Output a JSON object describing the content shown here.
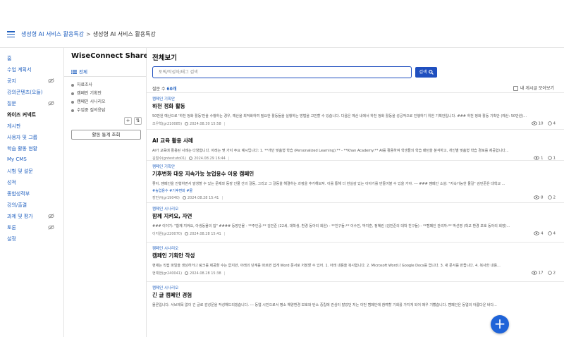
{
  "breadcrumb": {
    "link": "생성형 AI 서비스 활용특강",
    "separator": ">",
    "current": "생성형 AI 서비스 활용특강"
  },
  "leftnav": {
    "items": [
      {
        "label": "홈",
        "hidden_icon": false
      },
      {
        "label": "수업 계획서",
        "hidden_icon": false
      },
      {
        "label": "공지",
        "hidden_icon": true
      },
      {
        "label": "강의콘텐츠(오들)",
        "hidden_icon": false
      },
      {
        "label": "질문",
        "hidden_icon": true
      },
      {
        "label": "와이즈 커넥트",
        "hidden_icon": false,
        "active": true
      },
      {
        "label": "게시판",
        "hidden_icon": false
      },
      {
        "label": "사용자 및 그룹",
        "hidden_icon": false
      },
      {
        "label": "학습 활동 현황",
        "hidden_icon": false
      },
      {
        "label": "My CMS",
        "hidden_icon": false
      },
      {
        "label": "시험 및 설문",
        "hidden_icon": false
      },
      {
        "label": "성적",
        "hidden_icon": false
      },
      {
        "label": "종합성적부",
        "hidden_icon": false
      },
      {
        "label": "강의/출결",
        "hidden_icon": false
      },
      {
        "label": "과제 및 평가",
        "hidden_icon": true
      },
      {
        "label": "토론",
        "hidden_icon": true
      },
      {
        "label": "설정",
        "hidden_icon": false
      }
    ]
  },
  "midpanel": {
    "brand": "WiseConnect Share",
    "all_label": "전체",
    "categories": [
      "자료조사",
      "캠페인 기획안",
      "캠페인 시나리오",
      "수업중 질의응답"
    ],
    "add_label": "+",
    "sort_label": "⇅",
    "stats_button": "활동 통계 조회"
  },
  "main": {
    "title": "전체보기",
    "search_placeholder": "토픽/작성자/태그 검색",
    "search_button": "검색",
    "count_label": "질문 수",
    "count_value": "60개",
    "mine_label": "내 게시글 모아보기"
  },
  "posts": [
    {
      "category": "캠페인 기획안",
      "title": "하천 정화 활동",
      "excerpt": "50만원 예산으로 '하천 정화 활동'만을 수행하는 경우, 예산을 최적화하여 필요한 활동들을 실행하는 방법을 고민할 수 있습니다. 다음은 예산 내에서 하천 정화 활동을 성공적으로 진행하기 위한 기획안입니다. ### 하천 정화 활동 기획안 (예산: 50만원)...",
      "tags": "",
      "author": "조우혁(gr210085)",
      "date": "2024.08.30 15:58",
      "views": "10",
      "comments": "4"
    },
    {
      "category": "",
      "title": "AI 교육 활용 사례",
      "excerpt": "AI가 교육에 활용된 사례는 다양합니다. 아래는 몇 가지 주요 예시입니다: 1. **개인 맞춤형 학습 (Personalized Learning):** - **Khan Academy:** AI를 활용하여 학생들의 학습 패턴을 분석하고, 개인별 맞춤형 학습 경로를 제공합니다...",
      "tags": "",
      "author": "김철수(gntestuto01)",
      "date": "2024.08.29 16:44",
      "views": "1",
      "comments": "1"
    },
    {
      "category": "캠페인 기획안",
      "title": "기후변화 대응 지속가능 농업용수 이용 캠페인",
      "excerpt": "좋아, 캠페인을 진행하면서 발생할 수 있는 문제와 등장 인물 간의 갈등, 그리고 그 갈등을 해결하는 과정을 추가해보자. 이를 통해 더 현실감 있는 이야기를 만들어볼 수 있을 거야. --- ### 캠페인 소설: \"지속가능한 물길\" 김민준은 대학교 ...",
      "tags": "#농업용수 #기후변화 #물",
      "author": "장민규(gr19040)",
      "date": "2024.08.28 15:41",
      "views": "8",
      "comments": "2"
    },
    {
      "category": "캠페인 시나리오",
      "title": "함께 지켜요, 자연",
      "excerpt": "### 이야기: \"함께 지켜요, 아생동물의 집\" #### 등장인물 - **주인공:** 김민준 (22세, 대학생, 환경 동아리 회원) - **친구들:** 이수진, 박지훈, 정혜린 (김민준의 대학 친구들) - **캠페인 관리자:** 박선영 (학교 환경 보호 동아리 회장)...",
      "tags": "",
      "author": "이지원(gr220070)",
      "date": "2024.08.28 15:41",
      "views": "4",
      "comments": "4"
    },
    {
      "category": "캠페인 시나리오",
      "title": "캠페인 기획안 작성",
      "excerpt": "현재는 직접 파일을 생성하거나 링크를 제공할 수는 없지만, 아래의 단계를 따르면 쉽게 Word 문서로 저장할 수 있어. 1. 아래 내용을 복사합니다. 2. Microsoft Word나 Google Docs를 엽니다. 3. 새 문서를 만듭니다. 4. 복사한 내용...",
      "tags": "",
      "author": "현예현(gr240041)",
      "date": "2024.08.28 15:38",
      "views": "17",
      "comments": "2"
    },
    {
      "category": "캠페인 시나리오",
      "title": "긴 글 캠페인 경험",
      "excerpt": "물론입니다. 서브제목 없이 긴 글로 감성문을 작성해드리겠습니다. --- 동엽 시민으로서 평소 해양환경 보호와 탄소 중립에 관심이 많았던 저는 이번 캠페인에 참여할 기회를 가지게 되어 매우 기뻤습니다. 캠페인은 동엽의 아름다운 바다...",
      "tags": "",
      "author": "",
      "date": "",
      "views": "",
      "comments": ""
    }
  ],
  "fab_label": "+",
  "colors": {
    "accent": "#1f5fbf",
    "primary_button": "#1f4fbf",
    "fab": "#1f63d8"
  }
}
